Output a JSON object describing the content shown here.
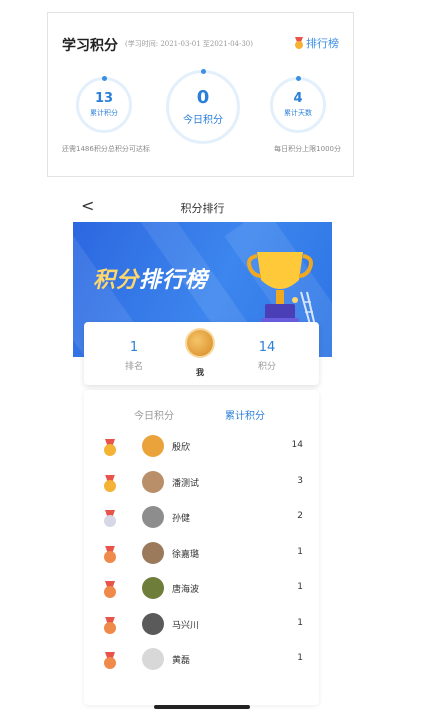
{
  "summary": {
    "title": "学习积分",
    "date_range": "(学习时间: 2021-03-01 至2021-04-30)",
    "rank_link": "排行榜",
    "cumulative": {
      "value": "13",
      "label": "累计积分"
    },
    "today": {
      "value": "0",
      "label": "今日积分"
    },
    "days": {
      "value": "4",
      "label": "累计天数"
    },
    "footer_left": "还需1486积分总积分可达标",
    "footer_right": "每日积分上限1000分"
  },
  "ranking_page": {
    "nav_title": "积分排行",
    "back_glyph": "<",
    "banner_title_accent": "积分",
    "banner_title_rest": "排行榜",
    "me": {
      "rank_value": "1",
      "rank_label": "排名",
      "name": "我",
      "score_value": "14",
      "score_label": "积分"
    },
    "tabs": [
      {
        "label": "今日积分",
        "active": false
      },
      {
        "label": "累计积分",
        "active": true
      }
    ],
    "rows": [
      {
        "name": "殷欣",
        "score": "14",
        "medal": "gold"
      },
      {
        "name": "潘测试",
        "score": "3",
        "medal": "gold"
      },
      {
        "name": "孙健",
        "score": "2",
        "medal": "silver"
      },
      {
        "name": "徐嘉璐",
        "score": "1",
        "medal": "bronze"
      },
      {
        "name": "唐海波",
        "score": "1",
        "medal": "bronze"
      },
      {
        "name": "马兴川",
        "score": "1",
        "medal": "bronze"
      },
      {
        "name": "黄磊",
        "score": "1",
        "medal": "bronze"
      }
    ]
  },
  "colors": {
    "accent_blue": "#2b7fd8",
    "medal_gold": "#f5b335",
    "medal_silver": "#d6d8e8",
    "medal_bronze": "#f08a4b",
    "ribbon_red": "#e8534a"
  }
}
